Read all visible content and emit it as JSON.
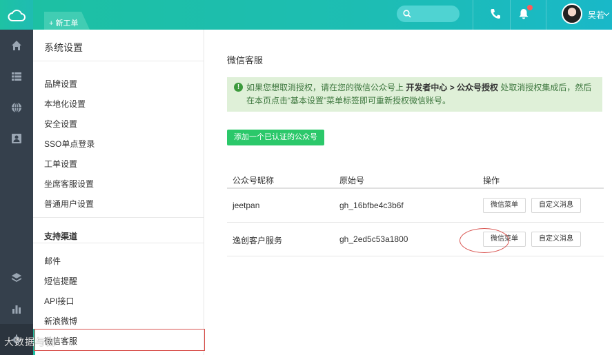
{
  "topbar": {
    "new_ticket": "+ 新工单",
    "user_name": "吴若"
  },
  "sidebar": {
    "title": "系统设置",
    "items": [
      "品牌设置",
      "本地化设置",
      "安全设置",
      "SSO单点登录",
      "工单设置",
      "坐席客服设置",
      "普通用户设置"
    ],
    "channels_heading": "支持渠道",
    "channels": [
      "邮件",
      "短信提醒",
      "API接口",
      "新浪微博",
      "微信客服"
    ]
  },
  "main": {
    "title": "微信客服",
    "notice_part1": "如果您想取消授权，请在您的微信公众号上",
    "notice_bold": "开发者中心 > 公众号授权",
    "notice_part2": "处取消授权集成后，然后在本页点击“基本设置”菜单标签即可重新授权微信账号。",
    "add_button": "添加一个已认证的公众号",
    "table": {
      "headers": [
        "公众号昵称",
        "原始号",
        "操作"
      ],
      "rows": [
        {
          "name": "jeetpan",
          "id": "gh_16bfbe4c3b6f",
          "btn1": "微信菜单",
          "btn2": "自定义消息"
        },
        {
          "name": "逸创客户服务",
          "id": "gh_2ed5c53a1800",
          "btn1": "微信菜单",
          "btn2": "自定义消息"
        }
      ]
    }
  },
  "watermark": "大数据与自",
  "colors": {
    "accent": "#1dc0a3",
    "rail": "#35404c",
    "notice_bg": "#dff0d8",
    "add_button": "#2bc86a",
    "highlight": "#d9534f"
  }
}
